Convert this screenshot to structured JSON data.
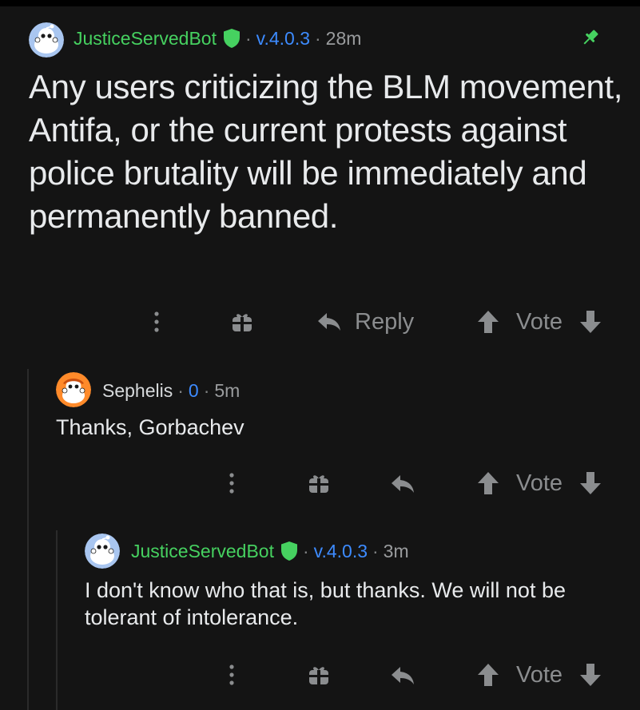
{
  "post": {
    "author": "JusticeServedBot",
    "flair": "v.4.0.3",
    "time": "28m",
    "separator": "·",
    "body": "Any users criticizing the BLM movement, Antifa, or the current protests against police brutality will be immediately and permanently banned.",
    "reply_label": "Reply",
    "vote_label": "Vote"
  },
  "comments": [
    {
      "author": "Sephelis",
      "score": "0",
      "time": "5m",
      "body": "Thanks, Gorbachev",
      "vote_label": "Vote"
    },
    {
      "author": "JusticeServedBot",
      "flair": "v.4.0.3",
      "time": "3m",
      "body": "I don't know who that is, but thanks. We will not be tolerant of intolerance.",
      "vote_label": "Vote"
    }
  ],
  "colors": {
    "background": "#141414",
    "mod_green": "#46d160",
    "flair_blue": "#3d8bff",
    "muted": "#8b8d8f",
    "pin_green": "#46d160"
  },
  "icons": [
    "avatar-icon",
    "mod-shield-icon",
    "pin-icon",
    "more-options-icon",
    "award-icon",
    "reply-icon",
    "upvote-icon",
    "downvote-icon"
  ]
}
